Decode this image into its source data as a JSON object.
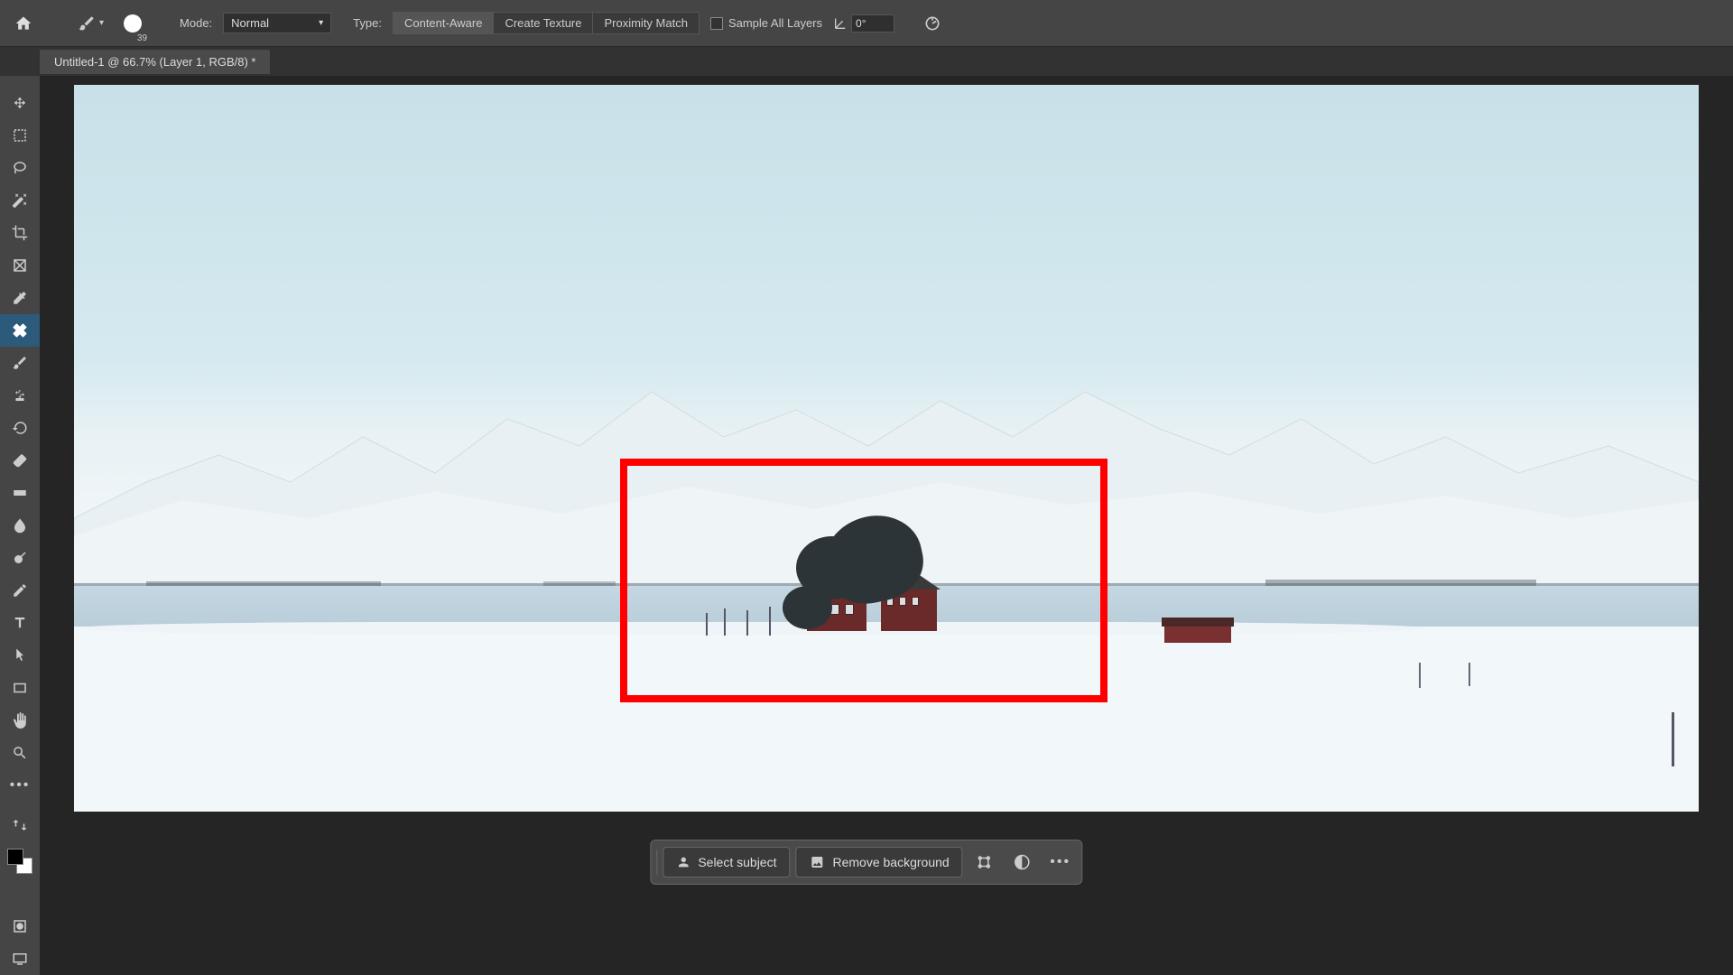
{
  "toolbar": {
    "brush_size": "39",
    "mode_label": "Mode:",
    "mode_value": "Normal",
    "type_label": "Type:",
    "type_options": [
      "Content-Aware",
      "Create Texture",
      "Proximity Match"
    ],
    "sample_all_label": "Sample All Layers",
    "angle_value": "0°"
  },
  "tab": {
    "title": "Untitled-1 @ 66.7% (Layer 1, RGB/8) *"
  },
  "action_bar": {
    "select_subject": "Select subject",
    "remove_bg": "Remove background"
  },
  "colors": {
    "annotation": "#ff0000"
  }
}
